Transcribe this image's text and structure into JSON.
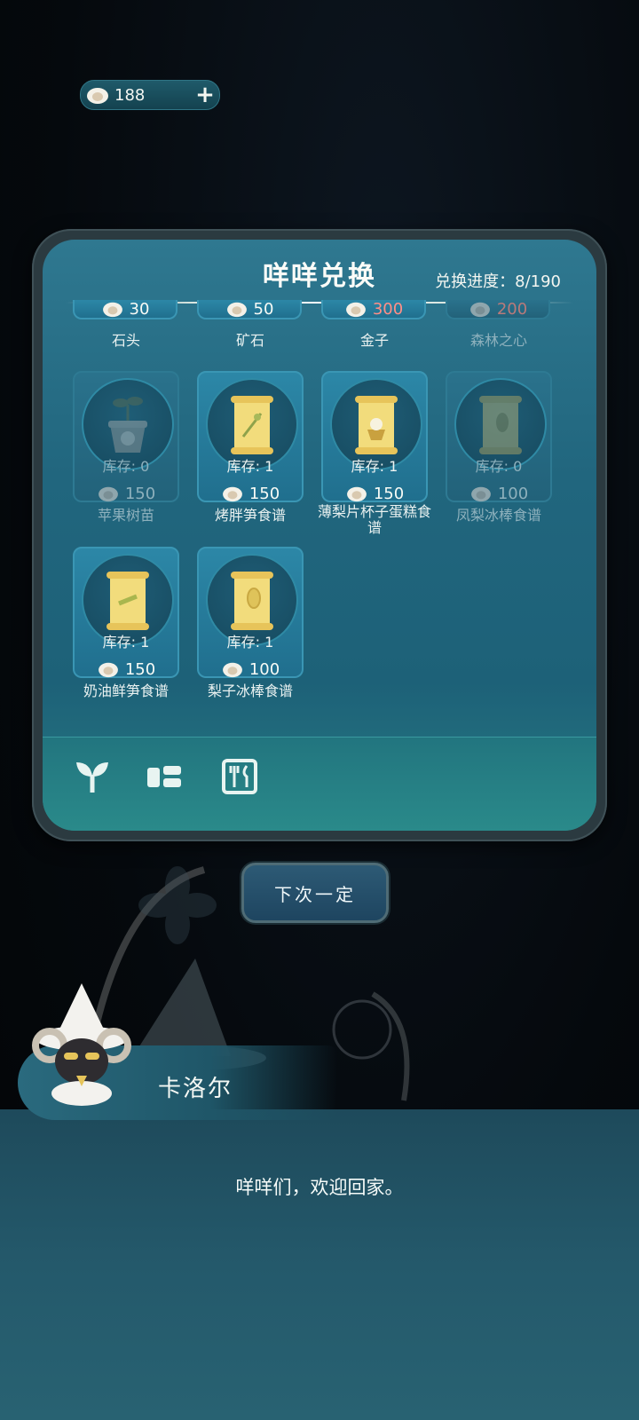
{
  "currency": {
    "amount": "188",
    "icon": "sheep-coin-icon",
    "add_icon": "plus-icon"
  },
  "shop": {
    "title": "咩咩兑换",
    "progress": "兑换进度：8/190",
    "partial_row": [
      {
        "name": "石头",
        "price": "30",
        "price_style": "normal"
      },
      {
        "name": "矿石",
        "price": "50",
        "price_style": "normal"
      },
      {
        "name": "金子",
        "price": "300",
        "price_style": "red"
      },
      {
        "name": "森林之心",
        "price": "200",
        "price_style": "dim-red"
      }
    ],
    "items": [
      {
        "name": "苹果树苗",
        "stock": "库存: 0",
        "price": "150",
        "icon": "sapling-pot-icon",
        "dim": true
      },
      {
        "name": "烤胖笋食谱",
        "stock": "库存: 1",
        "price": "150",
        "icon": "recipe-scroll-icon",
        "dim": false
      },
      {
        "name": "薄梨片杯子蛋糕食谱",
        "stock": "库存: 1",
        "price": "150",
        "icon": "recipe-scroll-icon",
        "dim": false
      },
      {
        "name": "凤梨冰棒食谱",
        "stock": "库存: 0",
        "price": "100",
        "icon": "recipe-scroll-icon",
        "dim": true
      },
      {
        "name": "奶油鲜笋食谱",
        "stock": "库存: 1",
        "price": "150",
        "icon": "recipe-scroll-icon",
        "dim": false
      },
      {
        "name": "梨子冰棒食谱",
        "stock": "库存: 1",
        "price": "100",
        "icon": "recipe-scroll-icon",
        "dim": false
      }
    ],
    "tabs": [
      {
        "icon": "sprout-icon"
      },
      {
        "icon": "resource-icon"
      },
      {
        "icon": "recipe-book-icon"
      }
    ]
  },
  "next_button": {
    "label": "下次一定"
  },
  "dialog": {
    "speaker": "卡洛尔",
    "line": "咩咩们，欢迎回家。"
  },
  "colors": {
    "panel": "#21667e",
    "price_red": "#ff8f87"
  }
}
